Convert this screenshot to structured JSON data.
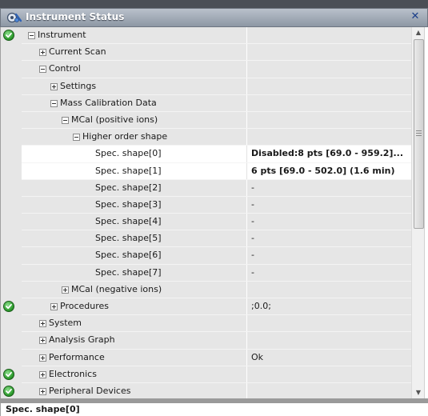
{
  "window": {
    "title": "Instrument Status"
  },
  "rows": [
    {
      "label": "Instrument",
      "value": "",
      "status": true,
      "depth": 0,
      "toggle": "minus"
    },
    {
      "label": "Current Scan",
      "value": "",
      "status": false,
      "depth": 1,
      "toggle": "plus"
    },
    {
      "label": "Control",
      "value": "",
      "status": false,
      "depth": 1,
      "toggle": "minus"
    },
    {
      "label": "Settings",
      "value": "",
      "status": false,
      "depth": 2,
      "toggle": "plus"
    },
    {
      "label": "Mass Calibration Data",
      "value": "",
      "status": false,
      "depth": 2,
      "toggle": "minus"
    },
    {
      "label": "MCal (positive ions)",
      "value": "",
      "status": false,
      "depth": 3,
      "toggle": "minus"
    },
    {
      "label": "Higher order shape",
      "value": "",
      "status": false,
      "depth": 4,
      "toggle": "minus"
    },
    {
      "label": "Spec. shape[0]",
      "value": "Disabled:8 pts   [69.0 - 959.2]...",
      "status": false,
      "depth": 5,
      "toggle": "",
      "bold": true
    },
    {
      "label": "Spec. shape[1]",
      "value": "6 pts  [69.0 - 502.0]  (1.6 min)",
      "status": false,
      "depth": 5,
      "toggle": "",
      "bold": true
    },
    {
      "label": "Spec. shape[2]",
      "value": "-",
      "status": false,
      "depth": 5,
      "toggle": ""
    },
    {
      "label": "Spec. shape[3]",
      "value": "-",
      "status": false,
      "depth": 5,
      "toggle": ""
    },
    {
      "label": "Spec. shape[4]",
      "value": "-",
      "status": false,
      "depth": 5,
      "toggle": ""
    },
    {
      "label": "Spec. shape[5]",
      "value": "-",
      "status": false,
      "depth": 5,
      "toggle": ""
    },
    {
      "label": "Spec. shape[6]",
      "value": "-",
      "status": false,
      "depth": 5,
      "toggle": ""
    },
    {
      "label": "Spec. shape[7]",
      "value": "-",
      "status": false,
      "depth": 5,
      "toggle": ""
    },
    {
      "label": "MCal (negative ions)",
      "value": "",
      "status": false,
      "depth": 3,
      "toggle": "plus"
    },
    {
      "label": "Procedures",
      "value": ";0.0;",
      "status": true,
      "depth": 2,
      "toggle": "plus"
    },
    {
      "label": "System",
      "value": "",
      "status": false,
      "depth": 1,
      "toggle": "plus"
    },
    {
      "label": "Analysis Graph",
      "value": "",
      "status": false,
      "depth": 1,
      "toggle": "plus"
    },
    {
      "label": "Performance",
      "value": "Ok",
      "status": false,
      "depth": 1,
      "toggle": "plus"
    },
    {
      "label": "Electronics",
      "value": "",
      "status": true,
      "depth": 1,
      "toggle": "plus"
    },
    {
      "label": "Peripheral Devices",
      "value": "",
      "status": true,
      "depth": 1,
      "toggle": "plus"
    }
  ],
  "footer": {
    "selected": "Spec. shape[0]"
  },
  "icons": {
    "window": "instrument-gear-icon",
    "close": "close-icon",
    "status_ok": "check-circle-icon"
  }
}
